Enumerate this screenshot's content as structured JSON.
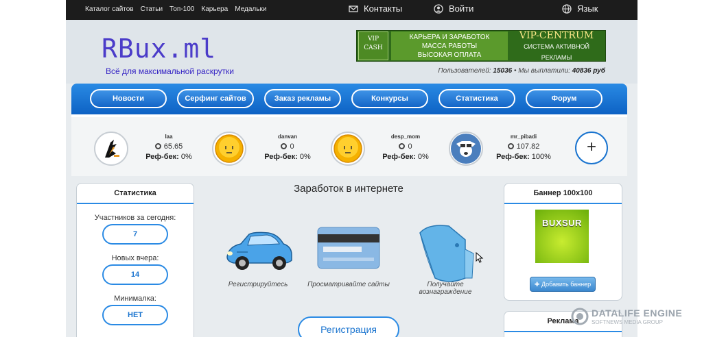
{
  "topbar": {
    "nav": [
      "Каталог сайтов",
      "Статьи",
      "Топ-100",
      "Карьера",
      "Медальки"
    ],
    "contacts_label": "Контакты",
    "login_label": "Войти",
    "language_label": "Язык"
  },
  "header": {
    "logo": "RBux.ml",
    "slogan": "Всё для максимальной раскрутки",
    "banner": {
      "vip_cash": "VIP CASH",
      "line1": "КАРЬЕРА И ЗАРАБОТОК",
      "line2": "МАССА РАБОТЫ",
      "line3": "ВЫСОКАЯ ОПЛАТА",
      "brand": "VIP-CENTRUM",
      "brand_sub": "СИСТЕМА АКТИВНОЙ РЕКЛАМЫ"
    },
    "stats": {
      "users_label": "Пользователей:",
      "users_value": "15036",
      "paid_label": "• Мы выплатили:",
      "paid_value": "40836 руб"
    }
  },
  "nav": [
    "Новости",
    "Серфинг сайтов",
    "Заказ рекламы",
    "Конкурсы",
    "Статистика",
    "Форум"
  ],
  "referrals": [
    {
      "name": "Iaa",
      "balance": "65.65",
      "refback_label": "Реф-бек:",
      "refback": "0%",
      "avatar": "hand-avatar"
    },
    {
      "name": "danvan",
      "balance": "0",
      "refback_label": "Реф-бек:",
      "refback": "0%",
      "avatar": "smiley-avatar"
    },
    {
      "name": "desp_mom",
      "balance": "0",
      "refback_label": "Реф-бек:",
      "refback": "0%",
      "avatar": "smiley-avatar"
    },
    {
      "name": "mr_pibadi",
      "balance": "107.82",
      "refback_label": "Реф-бек:",
      "refback": "100%",
      "avatar": "dog-avatar"
    }
  ],
  "add_referral_symbol": "+",
  "left": {
    "title": "Статистика",
    "items": [
      {
        "label": "Участников за сегодня:",
        "value": "7"
      },
      {
        "label": "Новых вчера:",
        "value": "14"
      },
      {
        "label": "Минималка:",
        "value": "НЕТ"
      }
    ]
  },
  "center": {
    "title": "Заработок в интернете",
    "steps": [
      {
        "icon": "car-icon",
        "caption": "Регистрируйтесь"
      },
      {
        "icon": "credit-card-icon",
        "caption": "Просматривайте сайты"
      },
      {
        "icon": "wallet-icon",
        "caption": "Получайте вознаграждение"
      }
    ],
    "register_label": "Регистрация"
  },
  "right": {
    "banner_title": "Баннер 100x100",
    "banner_text": "BUXSUR",
    "add_banner_label": "Добавить баннер",
    "ads_title": "Реклама"
  },
  "watermark": {
    "title": "DATALIFE ENGINE",
    "subtitle": "SOFTNEWS MEDIA GROUP"
  },
  "colors": {
    "accent": "#1a74cf",
    "nav_blue": "#0d62c4",
    "topbar": "#1c1c1c",
    "logo": "#4b3cc9"
  }
}
